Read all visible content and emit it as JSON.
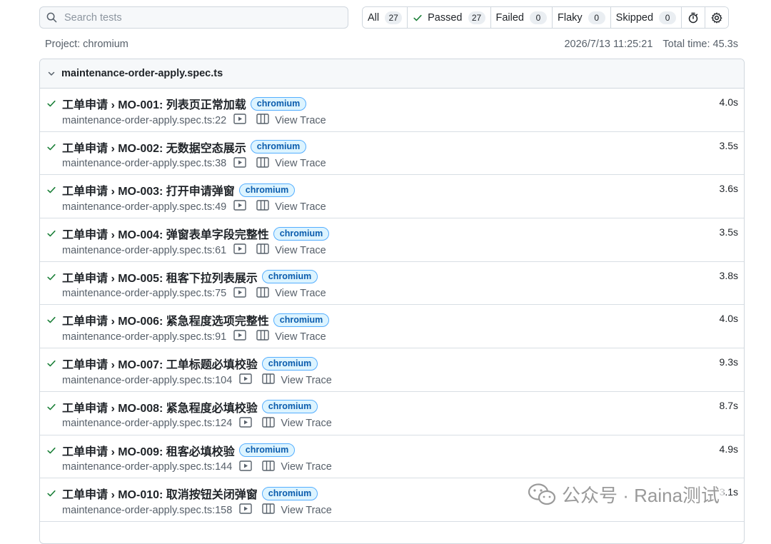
{
  "search": {
    "placeholder": "Search tests"
  },
  "filters": [
    {
      "label": "All",
      "count": "27"
    },
    {
      "label": "Passed",
      "count": "27"
    },
    {
      "label": "Failed",
      "count": "0"
    },
    {
      "label": "Flaky",
      "count": "0"
    },
    {
      "label": "Skipped",
      "count": "0"
    }
  ],
  "meta": {
    "project": "Project: chromium",
    "datetime": "2026/7/13 11:25:21",
    "total_time": "Total time: 45.3s"
  },
  "file": {
    "name": "maintenance-order-apply.spec.ts"
  },
  "tests": [
    {
      "title": "工单申请 › MO-001: 列表页正常加载",
      "tag": "chromium",
      "location": "maintenance-order-apply.spec.ts:22",
      "duration": "4.0s",
      "trace_label": "View Trace"
    },
    {
      "title": "工单申请 › MO-002: 无数据空态展示",
      "tag": "chromium",
      "location": "maintenance-order-apply.spec.ts:38",
      "duration": "3.5s",
      "trace_label": "View Trace"
    },
    {
      "title": "工单申请 › MO-003: 打开申请弹窗",
      "tag": "chromium",
      "location": "maintenance-order-apply.spec.ts:49",
      "duration": "3.6s",
      "trace_label": "View Trace"
    },
    {
      "title": "工单申请 › MO-004: 弹窗表单字段完整性",
      "tag": "chromium",
      "location": "maintenance-order-apply.spec.ts:61",
      "duration": "3.5s",
      "trace_label": "View Trace"
    },
    {
      "title": "工单申请 › MO-005: 租客下拉列表展示",
      "tag": "chromium",
      "location": "maintenance-order-apply.spec.ts:75",
      "duration": "3.8s",
      "trace_label": "View Trace"
    },
    {
      "title": "工单申请 › MO-006: 紧急程度选项完整性",
      "tag": "chromium",
      "location": "maintenance-order-apply.spec.ts:91",
      "duration": "4.0s",
      "trace_label": "View Trace"
    },
    {
      "title": "工单申请 › MO-007: 工单标题必填校验",
      "tag": "chromium",
      "location": "maintenance-order-apply.spec.ts:104",
      "duration": "9.3s",
      "trace_label": "View Trace"
    },
    {
      "title": "工单申请 › MO-008: 紧急程度必填校验",
      "tag": "chromium",
      "location": "maintenance-order-apply.spec.ts:124",
      "duration": "8.7s",
      "trace_label": "View Trace"
    },
    {
      "title": "工单申请 › MO-009: 租客必填校验",
      "tag": "chromium",
      "location": "maintenance-order-apply.spec.ts:144",
      "duration": "4.9s",
      "trace_label": "View Trace"
    },
    {
      "title": "工单申请 › MO-010: 取消按钮关闭弹窗",
      "tag": "chromium",
      "location": "maintenance-order-apply.spec.ts:158",
      "duration": "3.1s",
      "trace_label": "View Trace"
    }
  ],
  "watermark": {
    "text": "公众号 · Raina测试"
  },
  "colors": {
    "pass": "#1a7f37",
    "badge_bg": "#ddf4ff",
    "badge_border": "#54aeff",
    "badge_text": "#0a5cad"
  }
}
